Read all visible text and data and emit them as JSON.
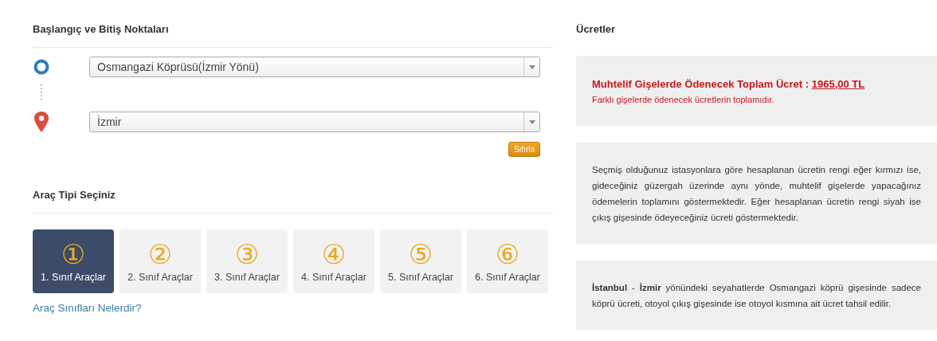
{
  "route": {
    "title": "Başlangıç ve Bitiş Noktaları",
    "start": {
      "value": "Osmangazi Köprüsü(İzmir Yönü)"
    },
    "end": {
      "value": "İzmir"
    },
    "reset_button": "Sıfırla"
  },
  "vehicle": {
    "title": "Araç Tipi Seçiniz",
    "classes": [
      {
        "symbol": "①",
        "label": "1. Sınıf Araçlar",
        "selected": true
      },
      {
        "symbol": "②",
        "label": "2. Sınıf Araçlar",
        "selected": false
      },
      {
        "symbol": "③",
        "label": "3. Sınıf Araçlar",
        "selected": false
      },
      {
        "symbol": "④",
        "label": "4. Sınıf Araçlar",
        "selected": false
      },
      {
        "symbol": "⑤",
        "label": "5. Sınıf Araçlar",
        "selected": false
      },
      {
        "symbol": "⑥",
        "label": "6. Sınıf Araçlar",
        "selected": false
      }
    ],
    "link": "Araç Sınıfları Nelerdir?"
  },
  "fees": {
    "title": "Ücretler",
    "total_label": "Muhtelif Gişelerde Ödenecek Toplam Ücret :",
    "total_value": "1965,00 TL",
    "total_note": "Farklı gişelerde ödenecek ücretlerin toplamıdır.",
    "notes": [
      "Seçmiş olduğunuz istasyonlara göre hesaplanan ücretin rengi eğer kırmızı ise, gideceğiniz güzergah üzerinde aynı yönde, muhtelif gişelerde yapacağınız ödemelerin toplamını göstermektedir. Eğer hesaplanan ücretin rengi siyah ise çıkış gişesinde ödeyeceğiniz ücreti göstermektedir.",
      "**İstanbul** - **İzmir** yönündeki seyahatlerde Osmangazi köprü gişesinde sadece köprü ücreti, otoyol çıkış gişesinde ise otoyol kısmına ait ücret tahsil edilir."
    ]
  }
}
